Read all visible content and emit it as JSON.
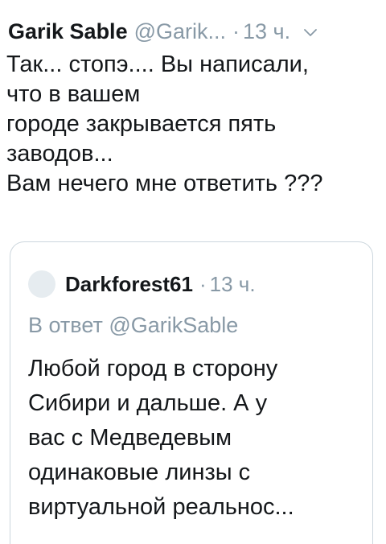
{
  "tweet": {
    "author_name": "Garik Sable",
    "handle": "@Garik...",
    "separator": "·",
    "time": "13 ч.",
    "text_lines": [
      "Так... стопэ.... Вы написали,",
      "что в вашем",
      "городе закрывается пять",
      "заводов...",
      "Вам нечего мне ответить ???"
    ]
  },
  "quoted_tweet": {
    "author_name": "Darkforest61",
    "separator": "·",
    "time": "13 ч.",
    "reply_prefix": "В ответ",
    "reply_mention": "@GarikSable",
    "text_lines": [
      "Любой город в сторону",
      "Сибири и дальше. А у",
      "вас с Медведевым",
      "одинаковые линзы с",
      "виртуальной реальнос..."
    ]
  },
  "icons": {
    "more_menu": "chevron-down-icon",
    "quoted_avatar": "avatar-placeholder"
  },
  "colors": {
    "primary_text": "#14171a",
    "secondary_text": "#8899a6",
    "border": "#ccd6dd",
    "avatar_placeholder": "#e6ecf0"
  }
}
